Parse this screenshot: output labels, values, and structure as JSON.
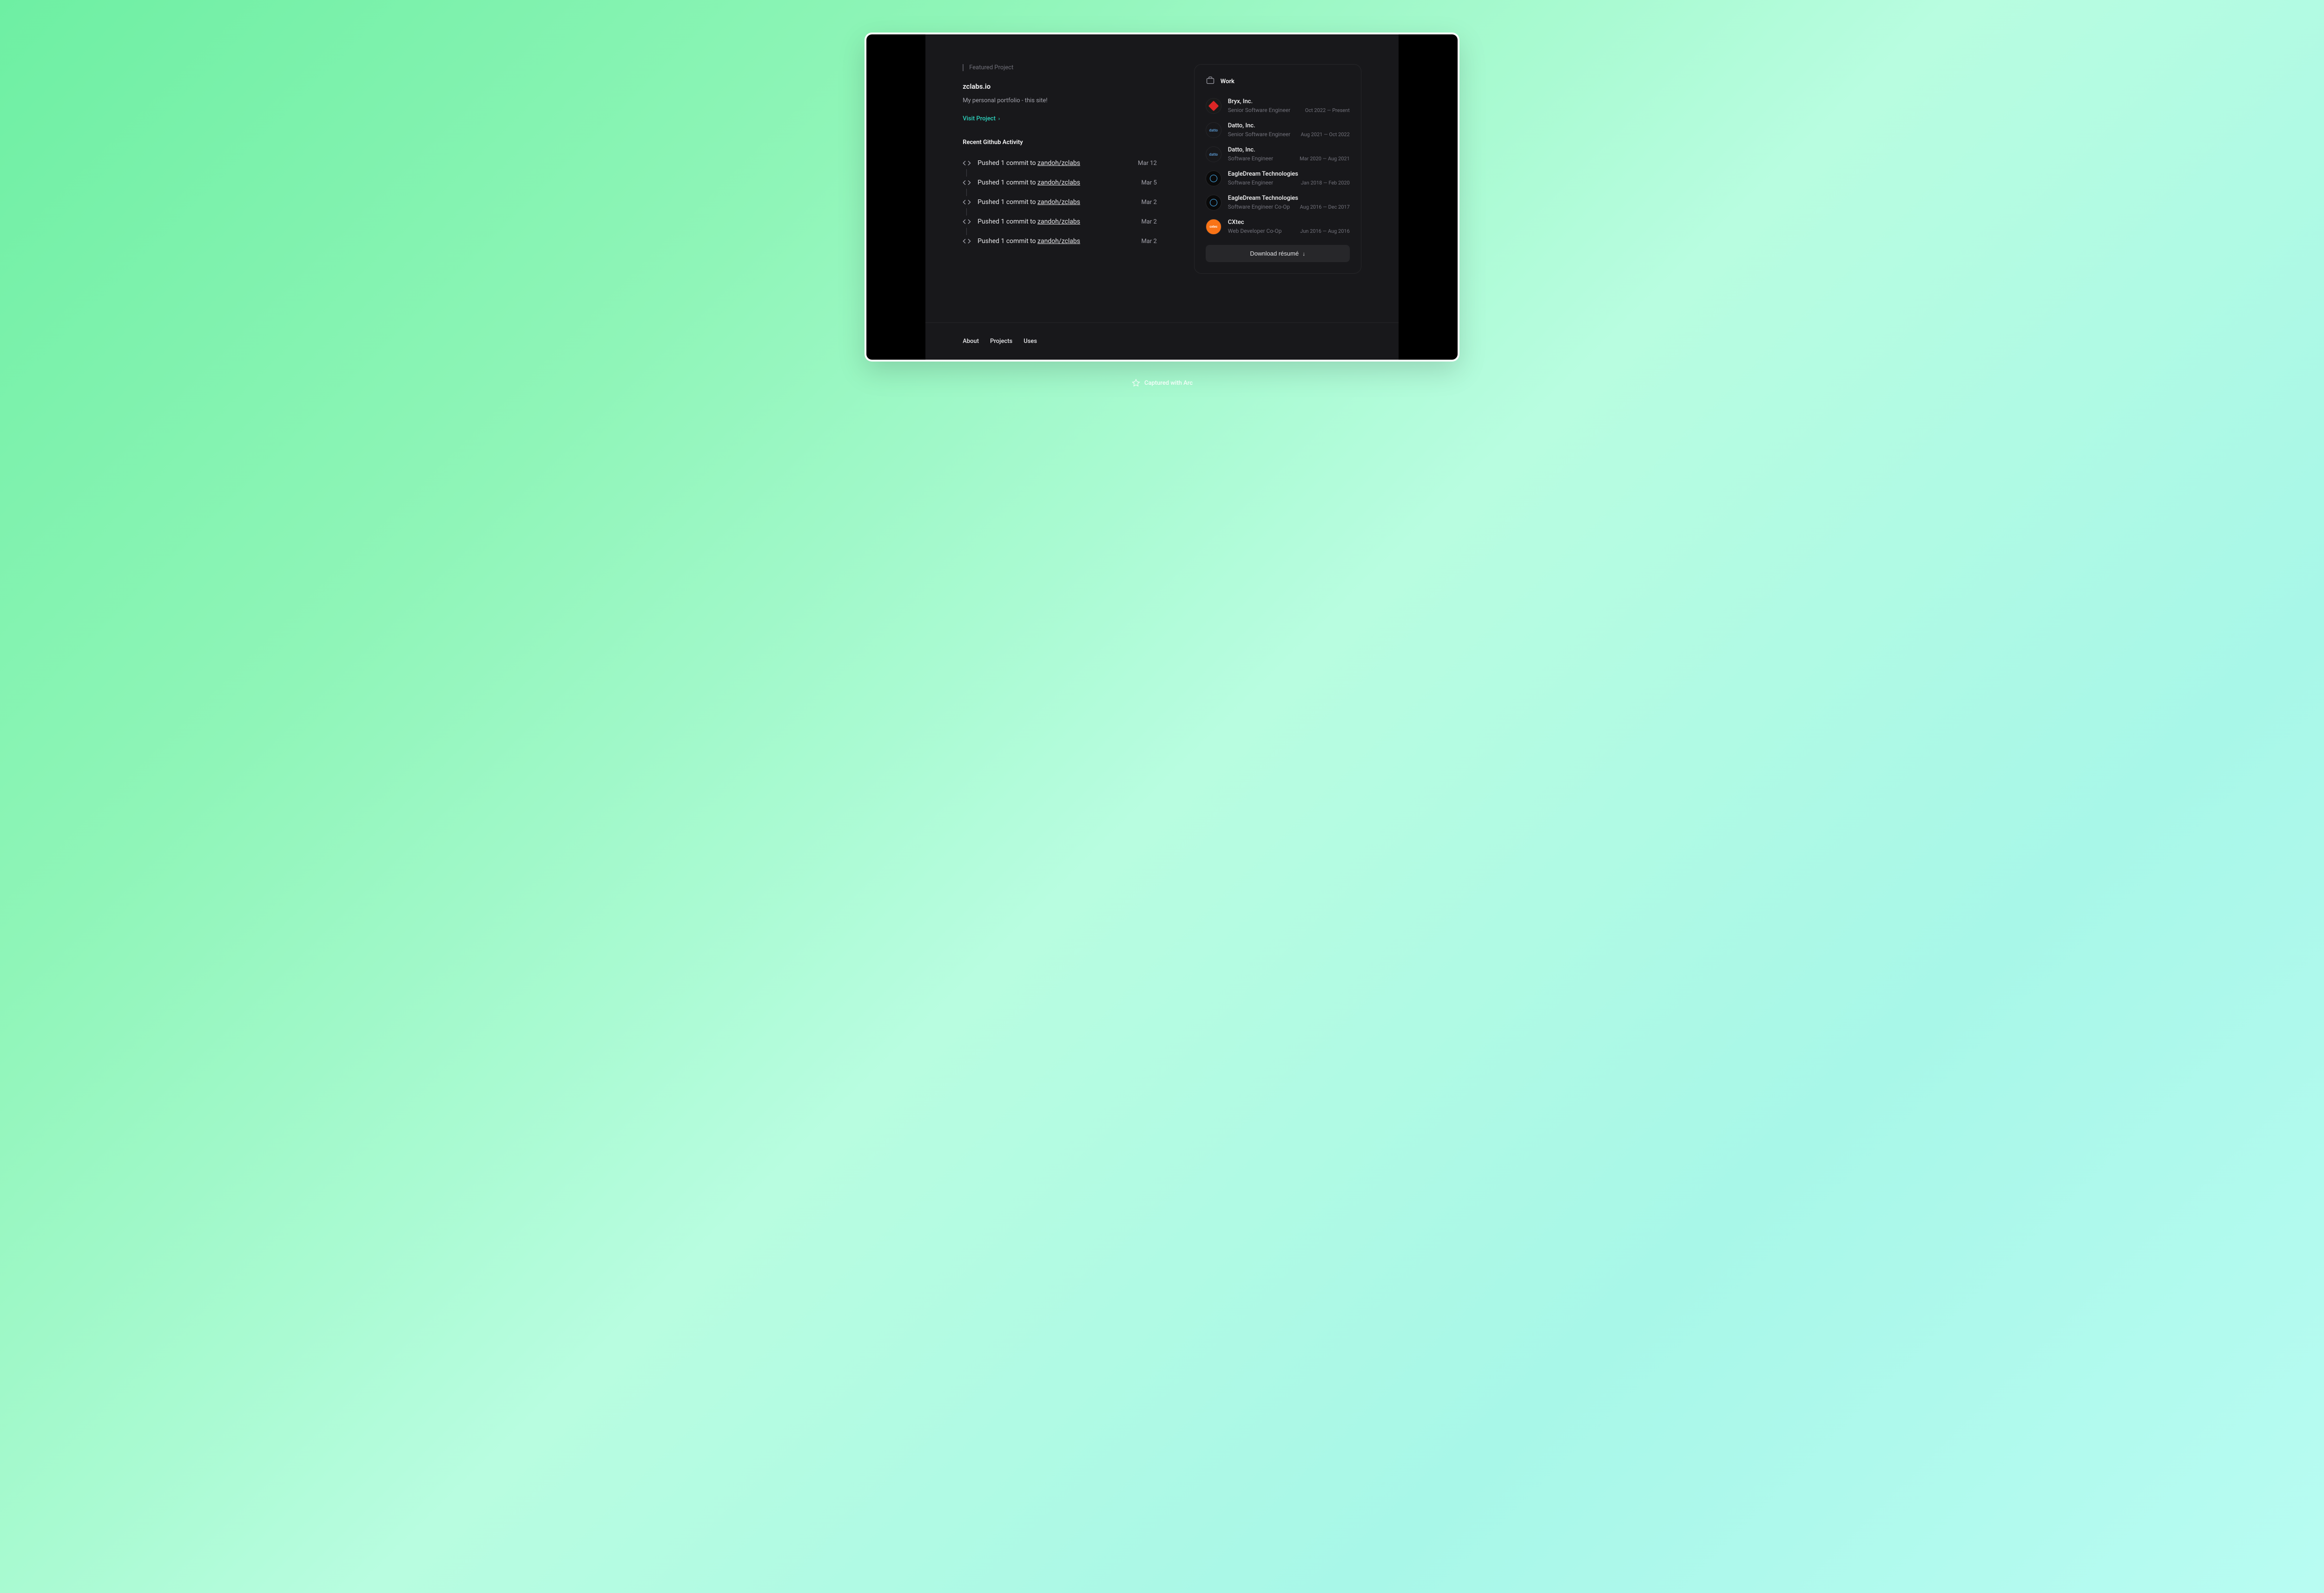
{
  "featured": {
    "label": "Featured Project",
    "title": "zclabs.io",
    "description": "My personal portfolio - this site!",
    "link_text": "Visit Project"
  },
  "activity": {
    "heading": "Recent Github Activity",
    "items": [
      {
        "prefix": "Pushed 1 commit to ",
        "repo": "zandoh/zclabs",
        "date": "Mar 12"
      },
      {
        "prefix": "Pushed 1 commit to ",
        "repo": "zandoh/zclabs",
        "date": "Mar 5"
      },
      {
        "prefix": "Pushed 1 commit to ",
        "repo": "zandoh/zclabs",
        "date": "Mar 2"
      },
      {
        "prefix": "Pushed 1 commit to ",
        "repo": "zandoh/zclabs",
        "date": "Mar 2"
      },
      {
        "prefix": "Pushed 1 commit to ",
        "repo": "zandoh/zclabs",
        "date": "Mar 2"
      }
    ]
  },
  "work": {
    "heading": "Work",
    "items": [
      {
        "company": "Bryx, Inc.",
        "role": "Senior Software Engineer",
        "dates": "Oct 2022 — Present",
        "logo": "bryx"
      },
      {
        "company": "Datto, Inc.",
        "role": "Senior Software Engineer",
        "dates": "Aug 2021 — Oct 2022",
        "logo": "datto"
      },
      {
        "company": "Datto, Inc.",
        "role": "Software Engineer",
        "dates": "Mar 2020 — Aug 2021",
        "logo": "datto"
      },
      {
        "company": "EagleDream Technologies",
        "role": "Software Engineer",
        "dates": "Jan 2018 — Feb 2020",
        "logo": "eagle"
      },
      {
        "company": "EagleDream Technologies",
        "role": "Software Engineer Co-Op",
        "dates": "Aug 2016 — Dec 2017",
        "logo": "eagle"
      },
      {
        "company": "CXtec",
        "role": "Web Developer Co-Op",
        "dates": "Jun 2016 — Aug 2016",
        "logo": "cxtec"
      }
    ],
    "download_label": "Download résumé"
  },
  "footer": {
    "links": [
      "About",
      "Projects",
      "Uses"
    ]
  },
  "badge": "Captured with Arc"
}
